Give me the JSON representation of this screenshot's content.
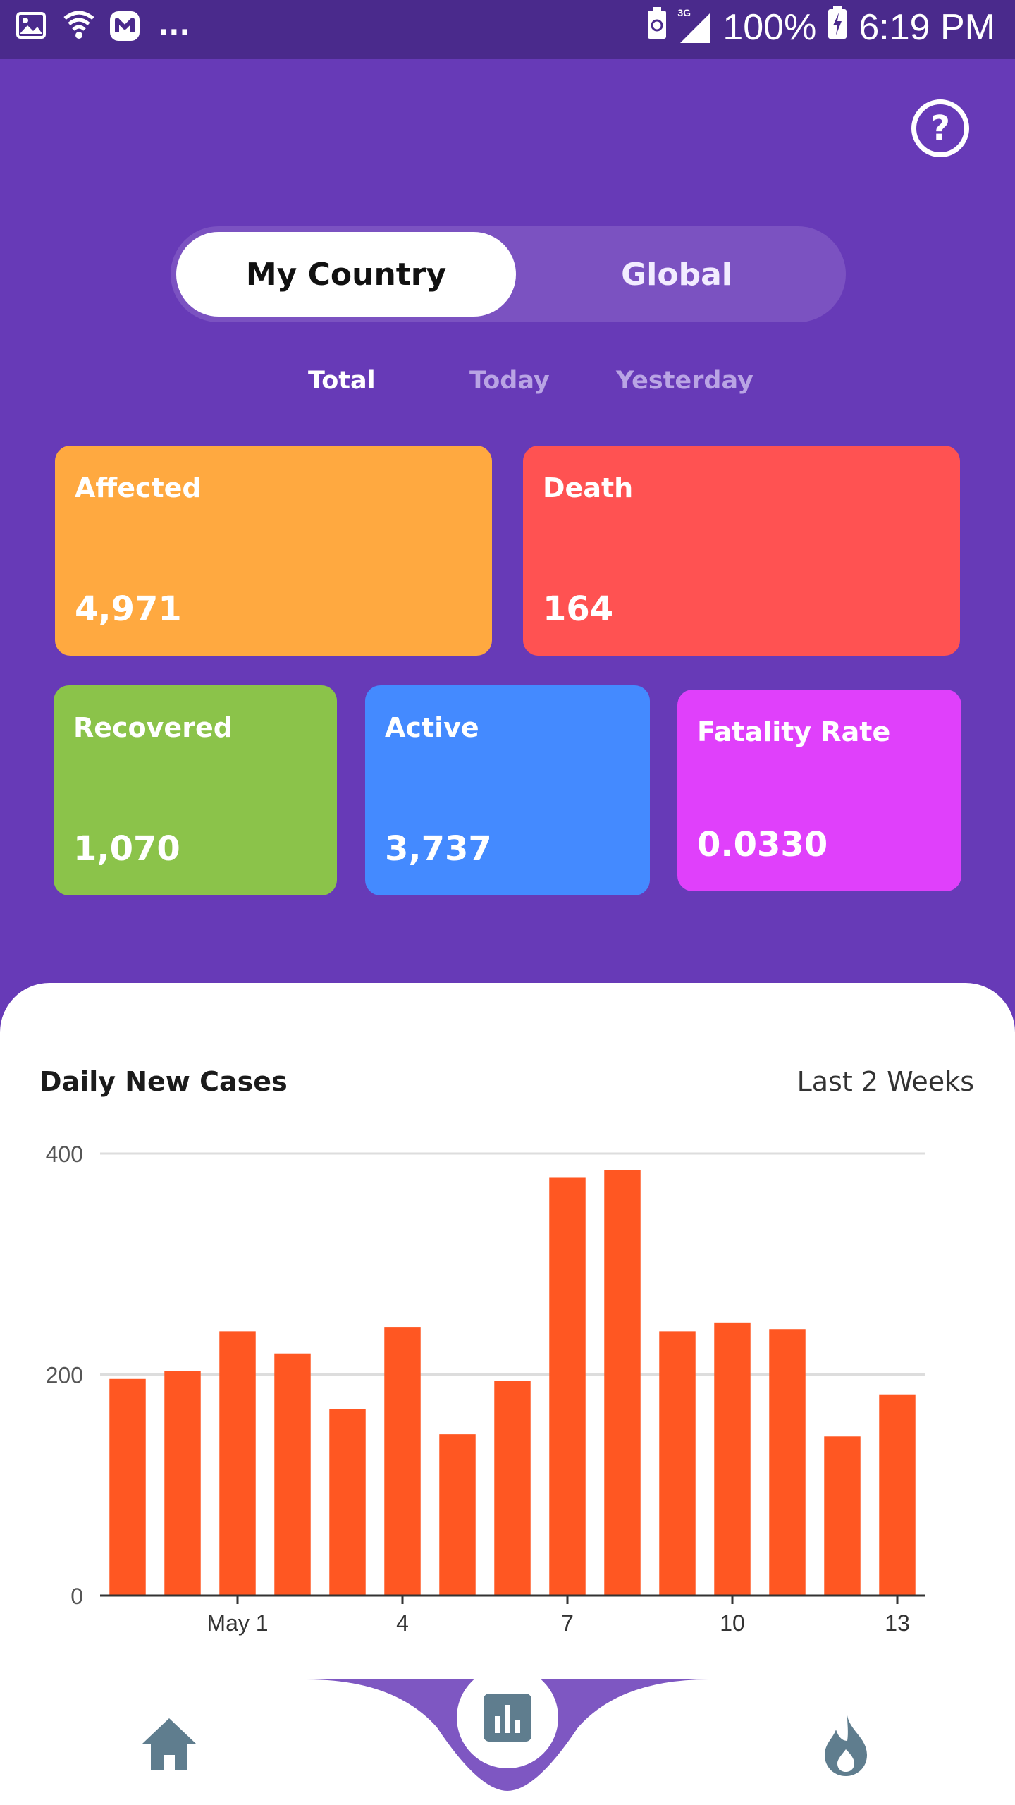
{
  "status_bar": {
    "battery": "100%",
    "time": "6:19 PM",
    "network": "3G",
    "notification_overflow": "..."
  },
  "scope_toggle": {
    "options": [
      "My Country",
      "Global"
    ],
    "selected": "My Country"
  },
  "period_tabs": {
    "items": [
      "Total",
      "Today",
      "Yesterday"
    ],
    "selected": "Total"
  },
  "stats": {
    "affected": {
      "label": "Affected",
      "value": "4,971",
      "color": "#ffa940"
    },
    "death": {
      "label": "Death",
      "value": "164",
      "color": "#ff5252"
    },
    "recovered": {
      "label": "Recovered",
      "value": "1,070",
      "color": "#8bc34a"
    },
    "active": {
      "label": "Active",
      "value": "3,737",
      "color": "#448aff"
    },
    "fatality_rate": {
      "label": "Fatality Rate",
      "value": "0.0330",
      "color": "#e040fb"
    }
  },
  "chart_section": {
    "title": "Daily New Cases",
    "range": "Last 2 Weeks"
  },
  "chart_data": {
    "type": "bar",
    "x": [
      29,
      30,
      1,
      2,
      3,
      4,
      5,
      6,
      7,
      8,
      9,
      10,
      11,
      12,
      13
    ],
    "values": [
      196,
      203,
      239,
      219,
      169,
      243,
      146,
      194,
      378,
      385,
      239,
      247,
      241,
      144,
      182
    ],
    "x_tick_values": [
      1,
      4,
      7,
      10,
      13
    ],
    "x_tick_labels": [
      "May 1",
      "4",
      "7",
      "10",
      "13"
    ],
    "y_ticks": [
      0,
      200,
      400
    ],
    "ylim": [
      0,
      400
    ],
    "bar_color": "#ff5722",
    "grid": true
  },
  "bottom_nav": {
    "items": [
      "home",
      "stats",
      "trending"
    ],
    "selected": "stats"
  },
  "colors": {
    "background": "#673ab7",
    "status_bar": "#4a2a8c",
    "nav_accent": "#7e57c2",
    "nav_icon": "#5f7d8e"
  }
}
